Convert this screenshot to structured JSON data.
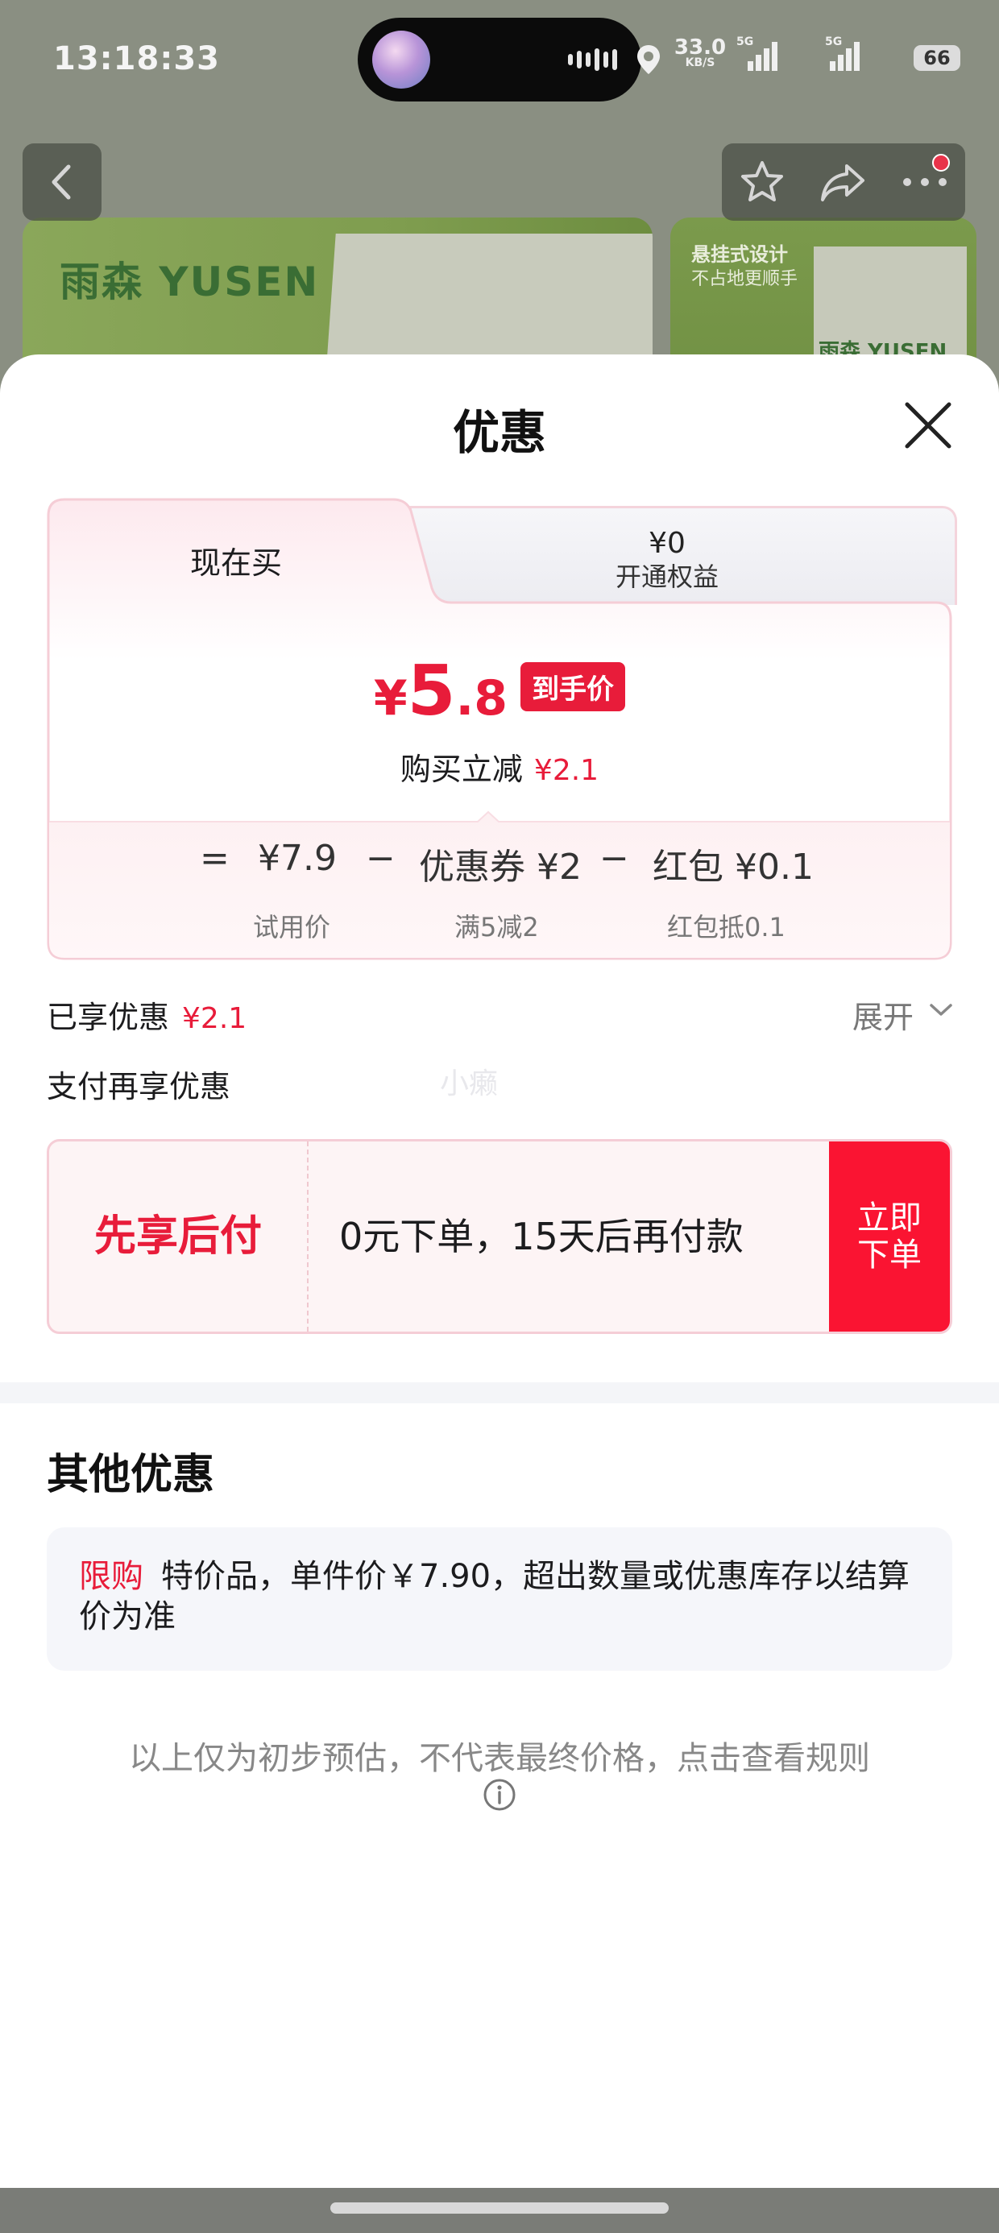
{
  "status_bar": {
    "time": "13:18:33",
    "net_speed_value": "33.0",
    "net_speed_unit": "KB/S",
    "sig1_label": "5G",
    "sig2_label": "5G",
    "battery": "66"
  },
  "background_page": {
    "brand": "雨森 YUSEN",
    "side_title": "悬挂式设计",
    "side_subtitle": "不占地更顺手",
    "side_brand": "雨森 YUSEN"
  },
  "sheet": {
    "title": "优惠",
    "tabs": {
      "now": "现在买",
      "member_amount": "¥0",
      "member_label": "开通权益"
    },
    "price": {
      "symbol": "¥",
      "integer": "5",
      "decimal": ".8",
      "tag": "到手价",
      "save_label": "购买立减",
      "save_amount": "¥2.1"
    },
    "breakdown": {
      "equals": "=",
      "trial_price": "¥7.9",
      "minus1": "−",
      "coupon": "优惠券 ¥2",
      "minus2": "−",
      "redpacket": "红包 ¥0.1",
      "trial_label": "试用价",
      "coupon_rule": "满5减2",
      "redpacket_rule": "红包抵0.1"
    },
    "enjoyed_label": "已享优惠",
    "enjoyed_amount": "¥2.1",
    "expand_label": "展开",
    "pay_more_label": "支付再享优惠",
    "watermark": "小癞",
    "bnpl": {
      "title": "先享后付",
      "description": "0元下单，15天后再付款",
      "button_line1": "立即",
      "button_line2": "下单"
    },
    "other": {
      "title": "其他优惠",
      "limit_tag": "限购",
      "limit_text": "特价品，单件价￥7.90，超出数量或优惠库存以结算价为准"
    },
    "footer_note": "以上仅为初步预估，不代表最终价格，点击查看规则"
  },
  "colors": {
    "accent_red": "#e81c3a",
    "button_red": "#fa1432",
    "card_border": "#f5cdd6"
  }
}
